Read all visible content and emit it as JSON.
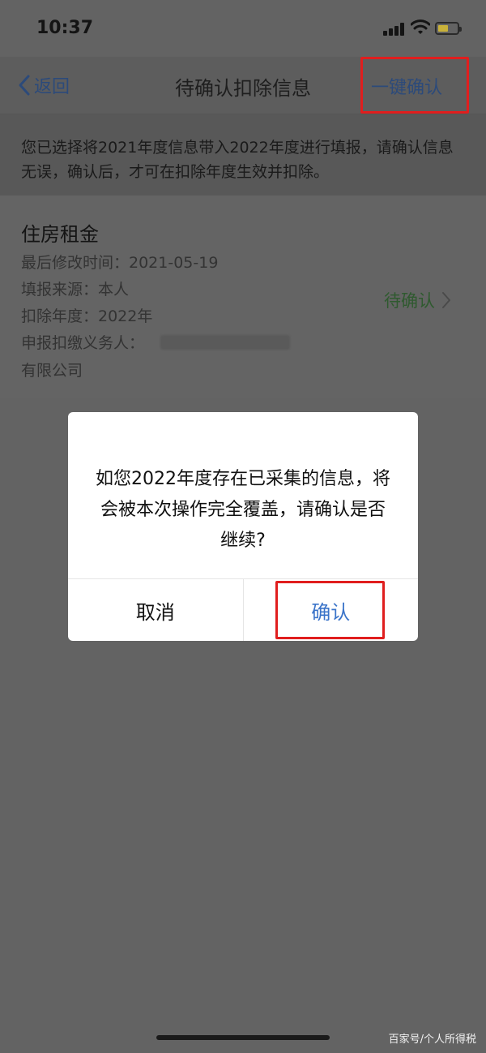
{
  "status_bar": {
    "time": "10:37"
  },
  "nav": {
    "back_label": "返回",
    "title": "待确认扣除信息",
    "confirm_all_label": "一键确认"
  },
  "notice": {
    "text": "您已选择将2021年度信息带入2022年度进行填报，请确认信息无误，确认后，才可在扣除年度生效并扣除。"
  },
  "record": {
    "title": "住房租金",
    "modified_time": "最后修改时间：2021-05-19",
    "source": "填报来源：本人",
    "deduction_year": "扣除年度：2022年",
    "withholding_agent_label": "申报扣缴义务人：",
    "withholding_agent_suffix": "有限公司",
    "status": "待确认"
  },
  "dialog": {
    "message": "如您2022年度存在已采集的信息，将会被本次操作完全覆盖，请确认是否继续?",
    "cancel_label": "取消",
    "confirm_label": "确认"
  },
  "watermark": "百家号/个人所得税"
}
